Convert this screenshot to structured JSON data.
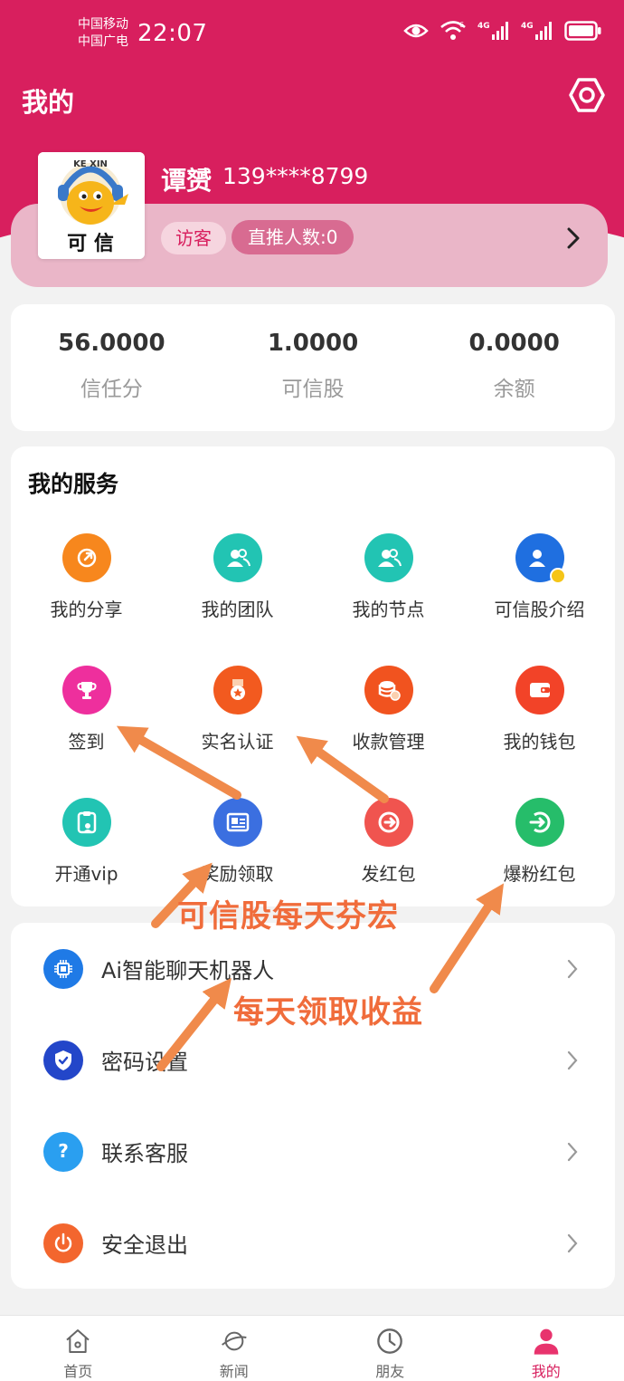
{
  "status_bar": {
    "carrier1": "中国移动",
    "carrier2": "中国广电",
    "time": "22:07"
  },
  "header": {
    "title": "我的",
    "settings_icon": "settings-hexagon-icon"
  },
  "profile": {
    "avatar_text": "可 信",
    "avatar_arc_text": "KE XIN",
    "name": "谭赟",
    "phone": "139****8799",
    "badge_role": "访客",
    "badge_direct": "直推人数:0"
  },
  "stats": [
    {
      "value": "56.0000",
      "label": "信任分"
    },
    {
      "value": "1.0000",
      "label": "可信股"
    },
    {
      "value": "0.0000",
      "label": "余额"
    }
  ],
  "services": {
    "title": "我的服务",
    "items": [
      {
        "label": "我的分享",
        "icon": "share-icon",
        "color": "#f7871d"
      },
      {
        "label": "我的团队",
        "icon": "team-icon",
        "color": "#22c4b3"
      },
      {
        "label": "我的节点",
        "icon": "node-icon",
        "color": "#22c4b3"
      },
      {
        "label": "可信股介绍",
        "icon": "stock-intro-icon",
        "color": "#1f6fe0"
      },
      {
        "label": "签到",
        "icon": "trophy-icon",
        "color": "#ee2f9d"
      },
      {
        "label": "实名认证",
        "icon": "medal-icon",
        "color": "#f25a1f"
      },
      {
        "label": "收款管理",
        "icon": "coins-icon",
        "color": "#f1531f"
      },
      {
        "label": "我的钱包",
        "icon": "wallet-icon",
        "color": "#f24328"
      },
      {
        "label": "开通vip",
        "icon": "vip-icon",
        "color": "#22c4b3"
      },
      {
        "label": "奖励领取",
        "icon": "reward-card-icon",
        "color": "#3b6fe0"
      },
      {
        "label": "发红包",
        "icon": "send-red-packet-icon",
        "color": "#f0544f"
      },
      {
        "label": "爆粉红包",
        "icon": "fan-red-packet-icon",
        "color": "#26bd6a"
      }
    ]
  },
  "settings_list": [
    {
      "label": "Ai智能聊天机器人",
      "icon": "chip-icon",
      "color": "#1f7ae6"
    },
    {
      "label": "密码设置",
      "icon": "shield-check-icon",
      "color": "#2346c9"
    },
    {
      "label": "联系客服",
      "icon": "question-bubble-icon",
      "color": "#2a9ff0"
    },
    {
      "label": "安全退出",
      "icon": "power-icon",
      "color": "#f3662e"
    }
  ],
  "annotations": {
    "line1": "可信股每天芬宏",
    "line2": "每天领取收益",
    "color": "#f06c3b"
  },
  "bottom_nav": [
    {
      "label": "首页",
      "icon": "home-icon"
    },
    {
      "label": "新闻",
      "icon": "planet-icon"
    },
    {
      "label": "朋友",
      "icon": "clock-icon"
    },
    {
      "label": "我的",
      "icon": "user-icon",
      "active": true
    }
  ],
  "colors": {
    "brand": "#d81f5e",
    "background": "#f2f2f2"
  }
}
